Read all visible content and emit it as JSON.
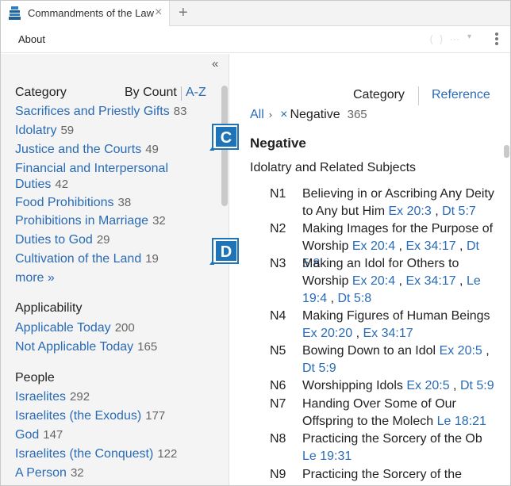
{
  "tab": {
    "title": "Commandments of the Law",
    "close": "×",
    "new": "+"
  },
  "menu": {
    "about": "About"
  },
  "sidebar": {
    "collapse": "«",
    "category": {
      "heading": "Category",
      "sort_by": "By Count",
      "sort_az": "A-Z",
      "items": [
        {
          "label": "Sacrifices and Priestly Gifts",
          "count": "83"
        },
        {
          "label": "Idolatry",
          "count": "59"
        },
        {
          "label": "Justice and the Courts",
          "count": "49"
        },
        {
          "label": "Financial and Interpersonal Duties",
          "count": "42"
        },
        {
          "label": "Food Prohibitions",
          "count": "38"
        },
        {
          "label": "Prohibitions in Marriage",
          "count": "32"
        },
        {
          "label": "Duties to God",
          "count": "29"
        },
        {
          "label": "Cultivation of the Land",
          "count": "19"
        }
      ],
      "more": "more »"
    },
    "applicability": {
      "heading": "Applicability",
      "items": [
        {
          "label": "Applicable Today",
          "count": "200"
        },
        {
          "label": "Not Applicable Today",
          "count": "165"
        }
      ]
    },
    "people": {
      "heading": "People",
      "items": [
        {
          "label": "Israelites",
          "count": "292"
        },
        {
          "label": "Israelites (the Exodus)",
          "count": "177"
        },
        {
          "label": "God",
          "count": "147"
        },
        {
          "label": "Israelites (the Conquest)",
          "count": "122"
        },
        {
          "label": "A Person",
          "count": "32"
        }
      ]
    }
  },
  "main": {
    "view_tabs": {
      "category": "Category",
      "reference": "Reference"
    },
    "breadcrumb": {
      "all": "All",
      "arrow": "›",
      "remove": "×",
      "filter": "Negative",
      "count": "365"
    },
    "heading": "Negative",
    "subheading": "Idolatry and Related Subjects",
    "commandments": [
      {
        "num": "N1",
        "text": "Believing in or Ascribing Any Deity to Any but Him",
        "refs": [
          "Ex 20:3",
          "Dt 5:7"
        ]
      },
      {
        "num": "N2",
        "text": "Making Images for the Purpose of Worship",
        "refs": [
          "Ex 20:4",
          "Ex 34:17",
          "Dt 5:8"
        ]
      },
      {
        "num": "N3",
        "text": "Making an Idol for Others to Worship",
        "refs": [
          "Ex 20:4",
          "Ex 34:17",
          "Le 19:4",
          "Dt 5:8"
        ]
      },
      {
        "num": "N4",
        "text": "Making Figures of Human Beings",
        "refs": [
          "Ex 20:20",
          "Ex 34:17"
        ]
      },
      {
        "num": "N5",
        "text": "Bowing Down to an Idol",
        "refs": [
          "Ex 20:5",
          "Dt 5:9"
        ]
      },
      {
        "num": "N6",
        "text": "Worshipping Idols",
        "refs": [
          "Ex 20:5",
          "Dt 5:9"
        ]
      },
      {
        "num": "N7",
        "text": "Handing Over Some of Our Offspring to the Molech",
        "refs": [
          "Le 18:21"
        ]
      },
      {
        "num": "N8",
        "text": "Practicing the Sorcery of the Ob",
        "refs": [
          "Le 19:31"
        ]
      },
      {
        "num": "N9",
        "text": "Practicing the Sorcery of the",
        "refs": []
      }
    ]
  },
  "callouts": {
    "c": "C",
    "d": "D"
  },
  "colors": {
    "link": "#2a6bb5",
    "badge": "#1f74b8",
    "sidebar_bg": "#f4f4f4"
  },
  "icons": {
    "app": "book-stack-icon",
    "kebab": "more-vertical-icon"
  }
}
